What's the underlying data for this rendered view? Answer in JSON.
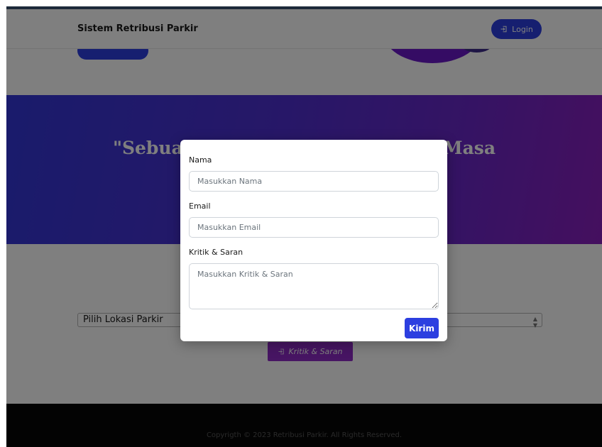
{
  "navbar": {
    "brand": "Sistem Retribusi Parkir",
    "login_label": "Login"
  },
  "banner": {
    "quote": "\"Sebuah Sistem Retribusi Parkir Masa"
  },
  "main": {
    "location_select": {
      "selected": "Pilih Lokasi Parkir"
    },
    "feedback_button_label": "Kritik & Saran"
  },
  "footer": {
    "copyright": "Copyrigth © 2023 Retribusi Parkir. All Rights Reserved."
  },
  "modal": {
    "name_label": "Nama",
    "name_placeholder": "Masukkan Nama",
    "email_label": "Email",
    "email_placeholder": "Masukkan Email",
    "feedback_label": "Kritik & Saran",
    "feedback_placeholder": "Masukkan Kritik & Saran",
    "submit_label": "Kirim"
  },
  "colors": {
    "primary": "#2c3fe0",
    "accent": "#8e2ac7",
    "footer": "#060606"
  },
  "icons": {
    "login": "sign-in-icon",
    "feedback": "sign-in-icon"
  }
}
